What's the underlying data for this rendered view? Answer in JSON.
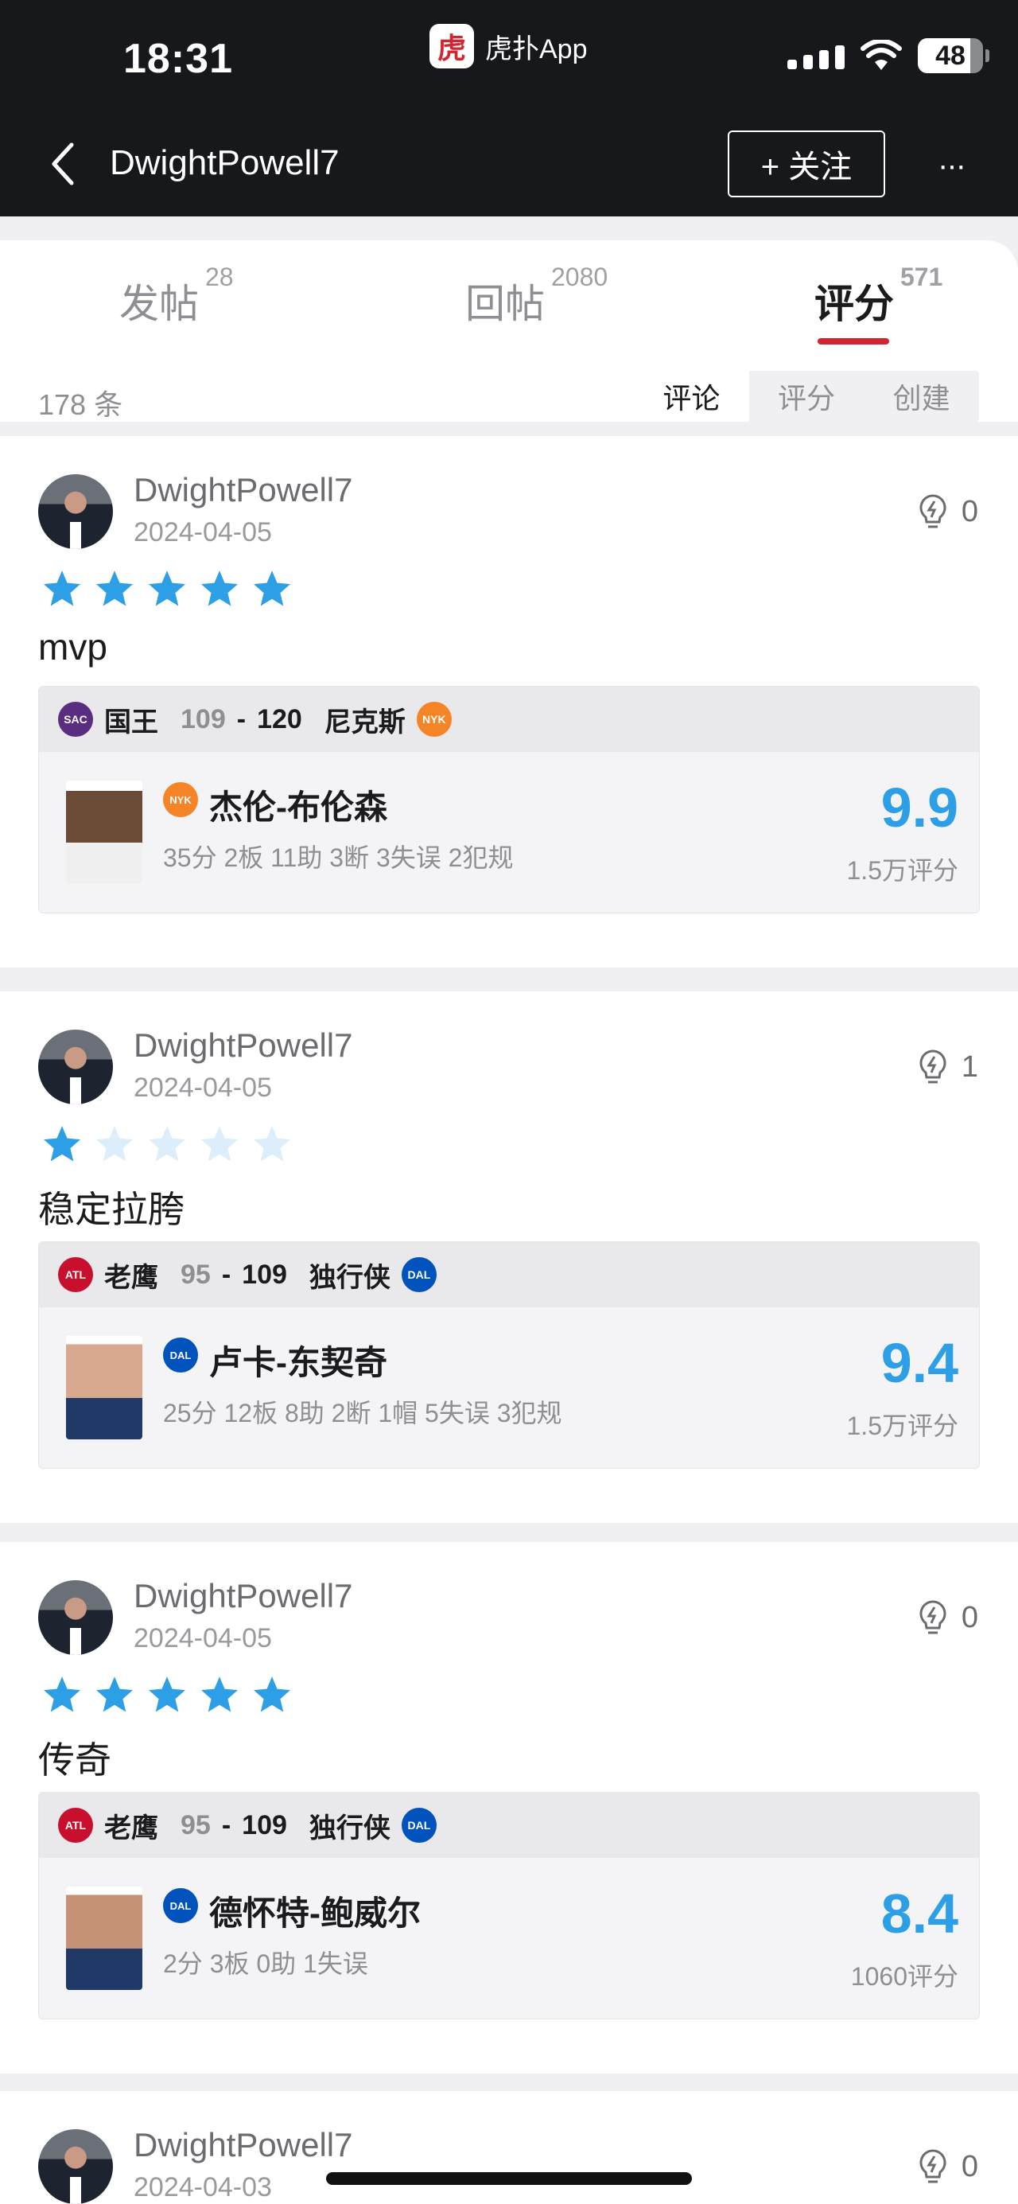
{
  "status_bar": {
    "time": "18:31",
    "app_logo_text": "虎",
    "app_name": "虎扑App",
    "battery": "48"
  },
  "header": {
    "back_label": "",
    "title": "DwightPowell7",
    "follow_label": "+ 关注",
    "more_label": "···"
  },
  "tabs": [
    {
      "label": "发帖",
      "count": "28"
    },
    {
      "label": "回帖",
      "count": "2080"
    },
    {
      "label": "评分",
      "count": "571",
      "active": true
    }
  ],
  "filter": {
    "count_text": "178 条",
    "segments": [
      "评论",
      "评分",
      "创建"
    ],
    "active_segment": "评论"
  },
  "cards": [
    {
      "user": "DwightPowell7",
      "date": "2024-04-05",
      "likes": "0",
      "stars": 5,
      "text": "mvp",
      "game": {
        "home_abbr": "SAC",
        "home_name": "国王",
        "home_score": "109",
        "away_score": "120",
        "away_name": "尼克斯",
        "away_abbr": "NYK"
      },
      "player": {
        "team_abbr": "NYK",
        "name": "杰伦-布伦森",
        "stats": "35分 2板 11助 3断 3失误 2犯规",
        "score": "9.9",
        "votes": "1.5万评分"
      }
    },
    {
      "user": "DwightPowell7",
      "date": "2024-04-05",
      "likes": "1",
      "stars": 1,
      "text": "稳定拉胯",
      "game": {
        "home_abbr": "ATL",
        "home_name": "老鹰",
        "home_score": "95",
        "away_score": "109",
        "away_name": "独行侠",
        "away_abbr": "DAL"
      },
      "player": {
        "team_abbr": "DAL",
        "name": "卢卡-东契奇",
        "stats": "25分 12板 8助 2断 1帽 5失误 3犯规",
        "score": "9.4",
        "votes": "1.5万评分"
      }
    },
    {
      "user": "DwightPowell7",
      "date": "2024-04-05",
      "likes": "0",
      "stars": 5,
      "text": "传奇",
      "game": {
        "home_abbr": "ATL",
        "home_name": "老鹰",
        "home_score": "95",
        "away_score": "109",
        "away_name": "独行侠",
        "away_abbr": "DAL"
      },
      "player": {
        "team_abbr": "DAL",
        "name": "德怀特-鲍威尔",
        "stats": "2分 3板 0助 1失误",
        "score": "8.4",
        "votes": "1060评分"
      }
    },
    {
      "user": "DwightPowell7",
      "date": "2024-04-03",
      "likes": "0"
    }
  ],
  "colors": {
    "accent": "#2c9fe6",
    "star_empty": "#dceefb",
    "tab_underline": "#d0262f",
    "sac": "#5a2d81",
    "nyk": "#f58426",
    "atl": "#c8102e",
    "dal": "#0053bc"
  },
  "icons": {
    "like": "lightbulb-icon",
    "star": "star-icon",
    "back": "chevron-left-icon"
  }
}
